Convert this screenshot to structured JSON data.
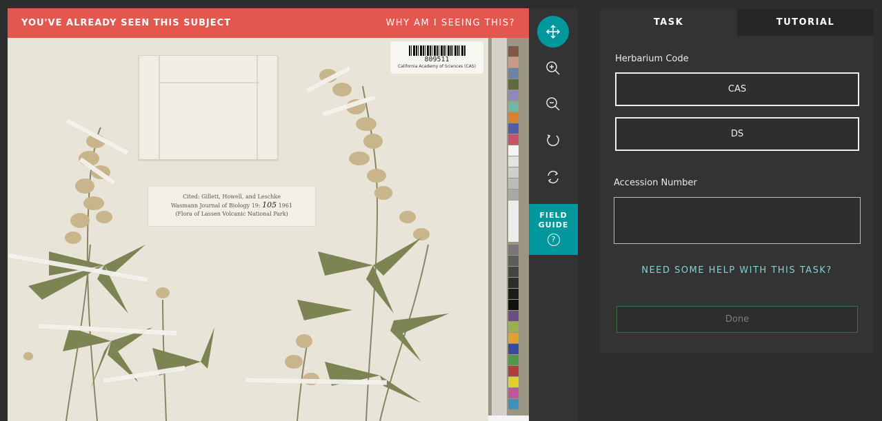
{
  "banner": {
    "seen_text": "YOU'VE ALREADY SEEN THIS SUBJECT",
    "why_text": "WHY AM I SEEING THIS?",
    "color": "#e4574f"
  },
  "specimen": {
    "barcode_number": "809511",
    "barcode_institution": "California Academy of Sciences (CAS)",
    "citation_line1": "Cited: Gillett, Howell, and Leschke",
    "citation_line2_prefix": "Wasmann Journal of Biology 19:",
    "citation_handwritten": "105",
    "citation_line2_suffix": "1961",
    "citation_line3": "(Flora of Lassen Volcanic National Park)"
  },
  "toolbar": {
    "tools": [
      {
        "name": "move-icon",
        "active": true
      },
      {
        "name": "zoom-in-icon",
        "active": false
      },
      {
        "name": "zoom-out-icon",
        "active": false
      },
      {
        "name": "rotate-icon",
        "active": false
      },
      {
        "name": "reset-icon",
        "active": false
      }
    ],
    "field_guide_line1": "FIELD",
    "field_guide_line2": "GUIDE",
    "field_guide_icon": "?",
    "accent": "#00979d"
  },
  "task": {
    "tabs": {
      "task": "TASK",
      "tutorial": "TUTORIAL"
    },
    "herbarium_question": "Herbarium Code",
    "answers": [
      "CAS",
      "DS"
    ],
    "accession_question": "Accession Number",
    "accession_value": "",
    "help_text": "NEED SOME HELP WITH THIS TASK?",
    "done_label": "Done"
  }
}
